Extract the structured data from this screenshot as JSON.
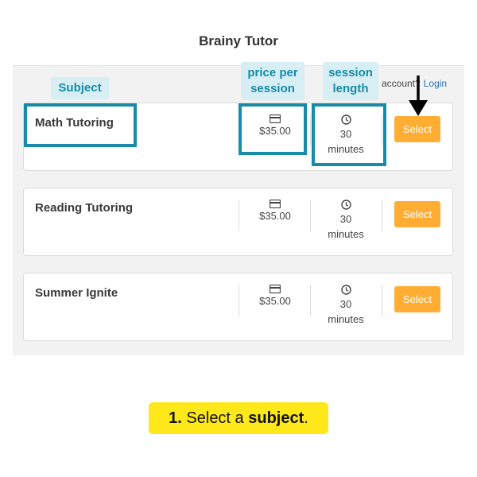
{
  "app": {
    "title": "Brainy Tutor"
  },
  "account": {
    "prompt_text": "n account?",
    "login_link": "Login"
  },
  "services": [
    {
      "name": "Math Tutoring",
      "price": "$35.00",
      "duration_value": "30",
      "duration_unit": "minutes",
      "select_label": "Select"
    },
    {
      "name": "Reading Tutoring",
      "price": "$35.00",
      "duration_value": "30",
      "duration_unit": "minutes",
      "select_label": "Select"
    },
    {
      "name": "Summer Ignite",
      "price": "$35.00",
      "duration_value": "30",
      "duration_unit": "minutes",
      "select_label": "Select"
    }
  ],
  "annotations": {
    "subject_tag": "Subject",
    "price_tag_line1": "price per",
    "price_tag_line2": "session",
    "length_tag_line1": "session",
    "length_tag_line2": "length",
    "highlight_color": "#178ba8"
  },
  "instruction": {
    "step": "1.",
    "text_before": "Select a",
    "bold_word": "subject",
    "text_after": "."
  },
  "icons": {
    "price": "credit-card-icon",
    "duration": "clock-icon",
    "pointer": "down-arrow-icon"
  },
  "colors": {
    "select_button": "#ffad33",
    "link": "#2a72b5",
    "instruction_bg": "#ffe81a"
  }
}
